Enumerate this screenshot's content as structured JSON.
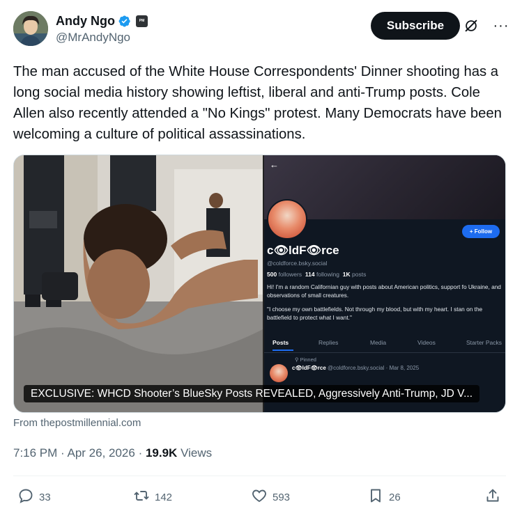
{
  "author": {
    "name": "Andy Ngo",
    "handle": "@MrAndyNgo",
    "org_badge": "PM",
    "verified_color": "#1d9bf0"
  },
  "header": {
    "subscribe_label": "Subscribe",
    "more_label": "···"
  },
  "tweet": {
    "text": "The man accused of the White House Correspondents' Dinner shooting has a long social media history showing leftist, liberal and anti-Trump posts. Cole Allen also recently attended a \"No Kings\" protest. Many Democrats have been welcoming a culture of political assassinations.",
    "card_caption": "EXCLUSIVE: WHCD Shooter’s BlueSky Posts REVEALED, Aggressively Anti-Trump, JD V...",
    "source": "From thepostmillennial.com",
    "time": "7:16 PM",
    "date": "Apr 26, 2026",
    "views_count": "19.9K",
    "views_label": "Views"
  },
  "bluesky": {
    "back": "←",
    "follow_label": "+ Follow",
    "display_name": "c👁ldF👁rce",
    "handle": "@coldforce.bsky.social",
    "followers_count": "500",
    "followers_label": "followers",
    "following_count": "114",
    "following_label": "following",
    "posts_count": "1K",
    "posts_label": "posts",
    "bio_1": "Hi! I'm a random Californian guy with posts about American politics, support fo Ukraine, and observations of small creatures.",
    "bio_2": "\"I choose my own battlefields. Not through my blood, but with my heart. I stan on the battlefield to protect what I want.\"",
    "tabs": [
      "Posts",
      "Replies",
      "Media",
      "Videos",
      "Starter Packs"
    ],
    "pinned_label": "⚲ Pinned",
    "post_name": "c👁ldF👁rce",
    "post_meta": "@coldforce.bsky.social · Mar 8, 2025"
  },
  "actions": {
    "replies": "33",
    "reposts": "142",
    "likes": "593",
    "bookmarks": "26"
  }
}
